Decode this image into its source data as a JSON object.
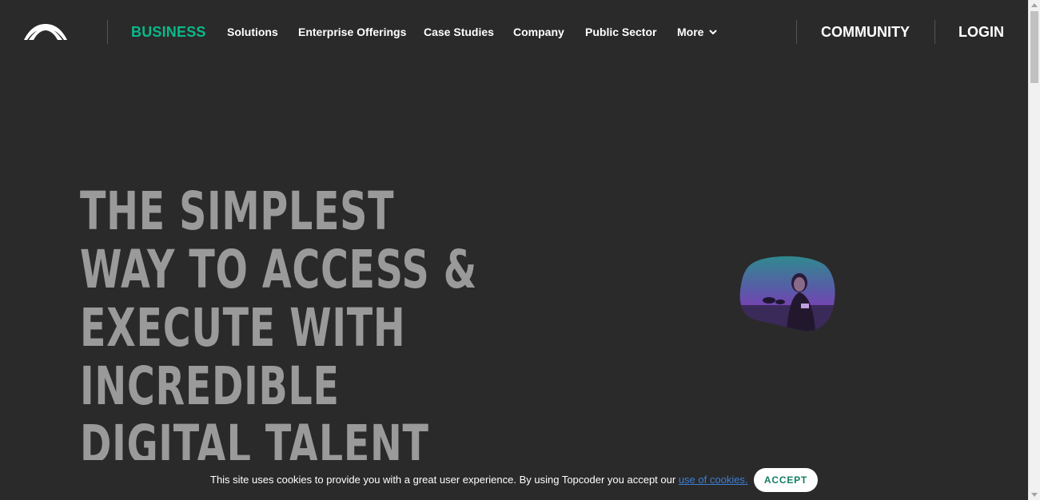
{
  "header": {
    "logo_icon": "topcoder-logo-icon",
    "business": "BUSINESS",
    "nav": [
      "Solutions",
      "Enterprise Offerings",
      "Case Studies",
      "Company",
      "Public Sector"
    ],
    "more": "More",
    "more_icon": "chevron-down-icon",
    "community": "COMMUNITY",
    "login": "LOGIN",
    "accent_color": "#0ab88a"
  },
  "hero": {
    "lines": [
      "THE SIMPLEST",
      "WAY TO ACCESS &",
      "EXECUTE WITH",
      "INCREDIBLE",
      "DIGITAL TALENT"
    ],
    "image_icon": "person-photo-blob"
  },
  "cookie": {
    "text": "This site uses cookies to provide you with a great user experience. By using Topcoder you accept our",
    "link": "use of cookies.",
    "accept": "ACCEPT"
  }
}
